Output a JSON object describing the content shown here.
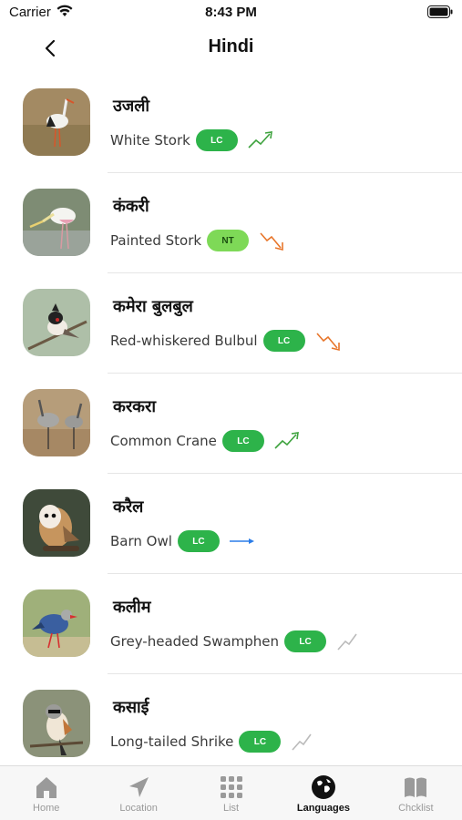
{
  "status": {
    "carrier": "Carrier",
    "time": "8:43 PM"
  },
  "nav": {
    "title": "Hindi"
  },
  "colors": {
    "lc_badge": "#2db34a",
    "nt_badge": "#7ed957",
    "trend_up": "#3fa33f",
    "trend_down": "#e8762b",
    "trend_stable": "#2b7de8",
    "trend_unknown": "#bbbbbb"
  },
  "birds": [
    {
      "hindi": "उजली",
      "english": "White Stork",
      "status": "LC",
      "trend": "up",
      "thumb_icon": "white-stork-photo"
    },
    {
      "hindi": "कंकरी",
      "english": "Painted Stork",
      "status": "NT",
      "trend": "down",
      "thumb_icon": "painted-stork-photo"
    },
    {
      "hindi": "कमेरा बुलबुल",
      "english": "Red-whiskered Bulbul",
      "status": "LC",
      "trend": "down",
      "thumb_icon": "bulbul-photo"
    },
    {
      "hindi": "करकरा",
      "english": "Common Crane",
      "status": "LC",
      "trend": "up",
      "thumb_icon": "crane-photo"
    },
    {
      "hindi": "करैल",
      "english": "Barn Owl",
      "status": "LC",
      "trend": "stable",
      "thumb_icon": "owl-photo"
    },
    {
      "hindi": "कलीम",
      "english": "Grey-headed Swamphen",
      "status": "LC",
      "trend": "unknown",
      "thumb_icon": "swamphen-photo"
    },
    {
      "hindi": "कसाई",
      "english": "Long-tailed Shrike",
      "status": "LC",
      "trend": "unknown",
      "thumb_icon": "shrike-photo"
    }
  ],
  "tabs": [
    {
      "label": "Home",
      "icon": "home-icon",
      "active": false
    },
    {
      "label": "Location",
      "icon": "location-arrow-icon",
      "active": false
    },
    {
      "label": "List",
      "icon": "grid-icon",
      "active": false
    },
    {
      "label": "Languages",
      "icon": "globe-icon",
      "active": true
    },
    {
      "label": "Chcklist",
      "icon": "book-icon",
      "active": false
    }
  ]
}
